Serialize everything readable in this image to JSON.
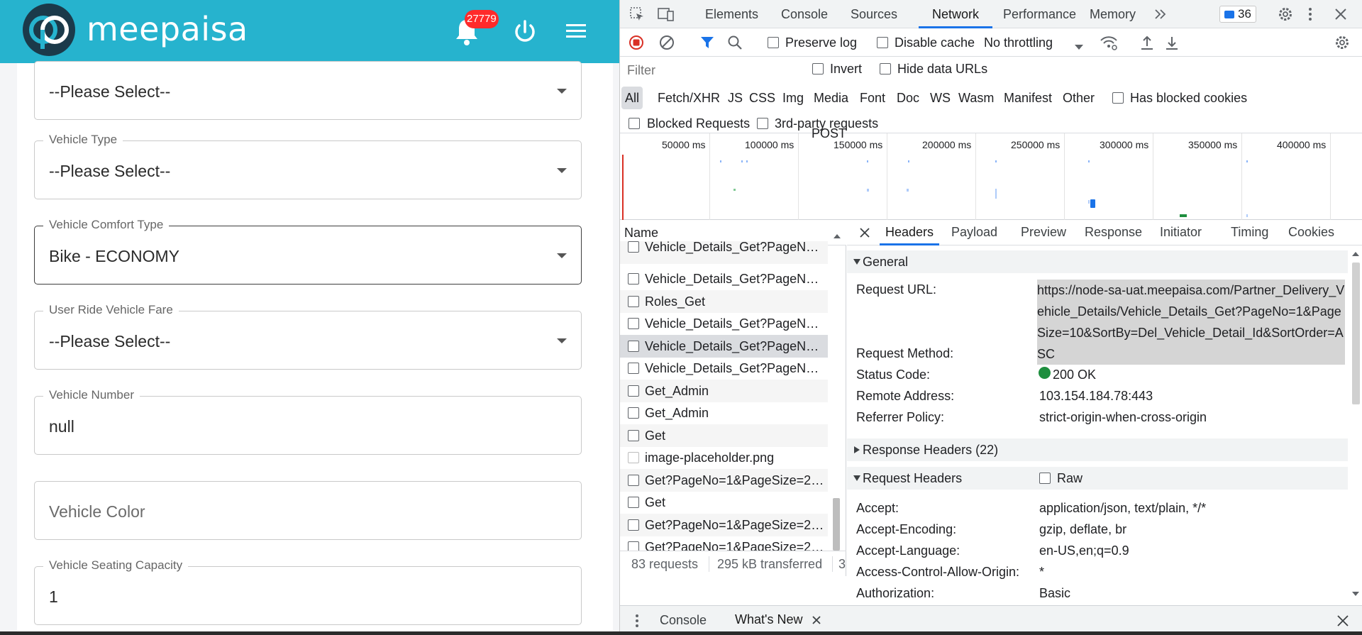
{
  "app": {
    "brand_name": "meepaisa",
    "notification_count": "27779",
    "colors": {
      "header_bg": "#26b3ce",
      "badge": "#ff2a2a"
    },
    "form": {
      "fields": [
        {
          "label": "",
          "value": "--Please Select--",
          "kind": "select"
        },
        {
          "label": "Vehicle Type",
          "value": "--Please Select--",
          "kind": "select"
        },
        {
          "label": "Vehicle Comfort Type",
          "value": "Bike - ECONOMY",
          "kind": "select"
        },
        {
          "label": "User Ride Vehicle Fare",
          "value": "--Please Select--",
          "kind": "select"
        },
        {
          "label": "Vehicle Number",
          "value": "null",
          "kind": "text"
        },
        {
          "label": "",
          "placeholder": "Vehicle Color",
          "kind": "text"
        },
        {
          "label": "Vehicle Seating Capacity",
          "value": "1",
          "kind": "text"
        }
      ]
    }
  },
  "devtools": {
    "tabs": [
      "Elements",
      "Console",
      "Sources",
      "Network",
      "Performance",
      "Memory"
    ],
    "active_tab": "Network",
    "message_count": "36",
    "toolbar": {
      "preserve_log": "Preserve log",
      "disable_cache": "Disable cache",
      "throttling": "No throttling"
    },
    "filter": {
      "placeholder": "Filter",
      "invert": "Invert",
      "hide_data_urls": "Hide data URLs",
      "types": [
        "All",
        "Fetch/XHR",
        "JS",
        "CSS",
        "Img",
        "Media",
        "Font",
        "Doc",
        "WS",
        "Wasm",
        "Manifest",
        "Other"
      ],
      "has_blocked_cookies": "Has blocked cookies",
      "blocked_requests": "Blocked Requests",
      "third_party": "3rd-party requests"
    },
    "timeline": {
      "ticks": [
        "50000 ms",
        "100000 ms",
        "150000 ms",
        "200000 ms",
        "250000 ms",
        "300000 ms",
        "350000 ms",
        "400000 ms"
      ]
    },
    "request_list": {
      "column": "Name",
      "rows": [
        "Vehicle_Details_Get?PageNo=...",
        "Vehicle_Details_Get?PageNo=...",
        "Roles_Get",
        "Vehicle_Details_Get?PageNo=...",
        "Vehicle_Details_Get?PageNo=...",
        "Vehicle_Details_Get?PageNo=...",
        "Get_Admin",
        "Get_Admin",
        "Get",
        "image-placeholder.png",
        "Get?PageNo=1&PageSize=20...",
        "Get",
        "Get?PageNo=1&PageSize=20...",
        "Get?PageNo=1&PageSize=20...",
        "Get?PageNo=1&PageSize=20..."
      ],
      "status_requests": "83 requests",
      "status_transferred": "295 kB transferred",
      "status_more": "3"
    },
    "detail": {
      "tabs": [
        "Headers",
        "Payload",
        "Preview",
        "Response",
        "Initiator",
        "Timing",
        "Cookies"
      ],
      "active_tab": "Headers",
      "general_title": "General",
      "general": {
        "request_url_key": "Request URL:",
        "request_url": "https://node-sa-uat.meepaisa.com/Partner_Delivery_Vehicle_Details/Vehicle_Details_Get?PageNo=1&PageSize=10&SortBy=Del_Vehicle_Detail_Id&SortOrder=ASC",
        "rows": [
          {
            "key": "Request Method:",
            "value": "POST"
          },
          {
            "key": "Status Code:",
            "value": "200 OK"
          },
          {
            "key": "Remote Address:",
            "value": "103.154.184.78:443"
          },
          {
            "key": "Referrer Policy:",
            "value": "strict-origin-when-cross-origin"
          }
        ]
      },
      "response_headers_title": "Response Headers (22)",
      "request_headers_title": "Request Headers",
      "raw_label": "Raw",
      "request_headers": [
        {
          "key": "Accept:",
          "value": "application/json, text/plain, */*"
        },
        {
          "key": "Accept-Encoding:",
          "value": "gzip, deflate, br"
        },
        {
          "key": "Accept-Language:",
          "value": "en-US,en;q=0.9"
        },
        {
          "key": "Access-Control-Allow-Origin:",
          "value": "*"
        },
        {
          "key": "Authorization:",
          "value": "Basic"
        }
      ]
    },
    "drawer": {
      "tabs": [
        "Console",
        "What's New"
      ],
      "active_tab": "What's New"
    }
  }
}
